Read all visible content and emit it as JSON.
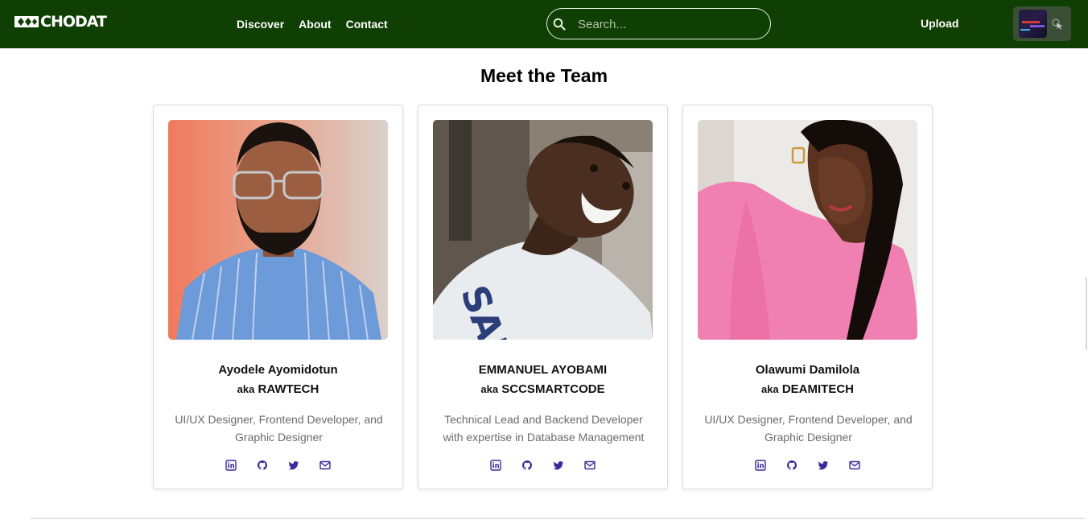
{
  "brand": {
    "logo_text": "CHODAT",
    "color": "#0f3f02"
  },
  "nav": {
    "links": [
      "Discover",
      "About",
      "Contact"
    ],
    "upload_label": "Upload"
  },
  "search": {
    "placeholder": "Search...",
    "value": "",
    "icon": "search-icon"
  },
  "user": {
    "avatar_icon": "user-avatar",
    "pointer_icon": "cursor-icon"
  },
  "main": {
    "title": "Meet the Team",
    "team": [
      {
        "name": "Ayodele Ayomidotun",
        "aka_prefix": "aka",
        "handle": "RAWTECH",
        "role": "UI/UX Designer, Frontend Developer, and Graphic Designer",
        "socials": [
          "linkedin-icon",
          "github-icon",
          "twitter-icon",
          "email-icon"
        ]
      },
      {
        "name": "EMMANUEL AYOBAMI",
        "aka_prefix": "aka",
        "handle": "SCCSMARTCODE",
        "role": "Technical Lead and Backend Developer with expertise in Database Management",
        "socials": [
          "linkedin-icon",
          "github-icon",
          "twitter-icon",
          "email-icon"
        ]
      },
      {
        "name": "Olawumi Damilola",
        "aka_prefix": "aka",
        "handle": "DEAMITECH",
        "role": "UI/UX Designer, Frontend Developer, and Graphic Designer",
        "socials": [
          "linkedin-icon",
          "github-icon",
          "twitter-icon",
          "email-icon"
        ]
      }
    ],
    "social_icon_color": "#3b2a9a"
  }
}
